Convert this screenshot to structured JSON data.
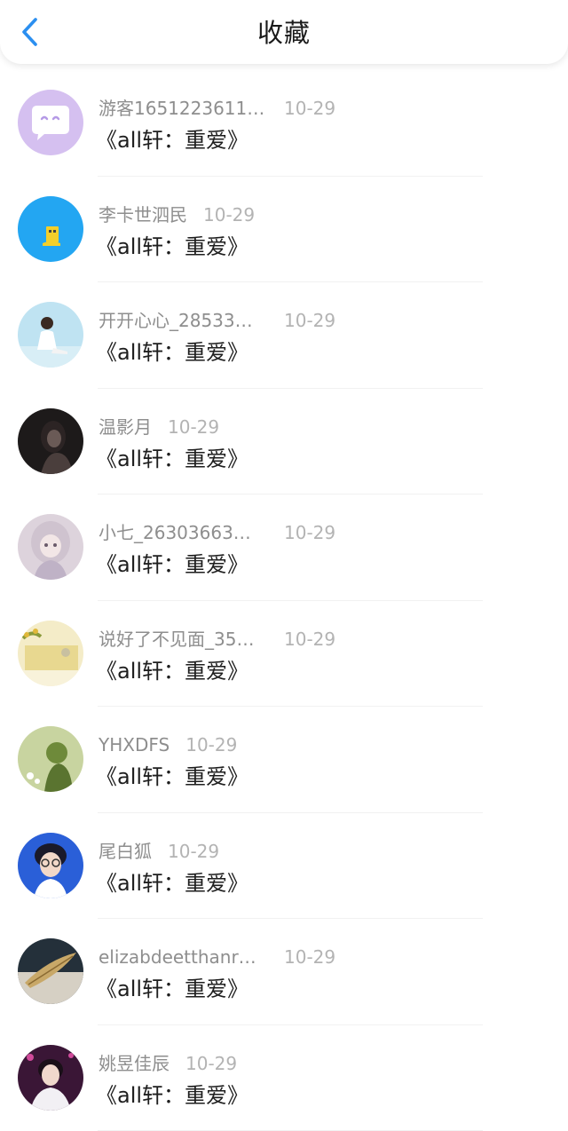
{
  "header": {
    "title": "收藏",
    "back_icon": "chevron-left-icon",
    "accent_color": "#2b8ff0"
  },
  "favorites": [
    {
      "user": "游客1651223611…",
      "date": "10-29",
      "title": "《all轩：重爱》"
    },
    {
      "user": "李卡世泗民",
      "date": "10-29",
      "title": "《all轩：重爱》"
    },
    {
      "user": "开开心心_28533…",
      "date": "10-29",
      "title": "《all轩：重爱》"
    },
    {
      "user": "温影月",
      "date": "10-29",
      "title": "《all轩：重爱》"
    },
    {
      "user": "小七_26303663…",
      "date": "10-29",
      "title": "《all轩：重爱》"
    },
    {
      "user": "说好了不见面_35…",
      "date": "10-29",
      "title": "《all轩：重爱》"
    },
    {
      "user": "YHXDFS",
      "date": "10-29",
      "title": "《all轩：重爱》"
    },
    {
      "user": "尾白狐",
      "date": "10-29",
      "title": "《all轩：重爱》"
    },
    {
      "user": "elizabdeetthanr…",
      "date": "10-29",
      "title": "《all轩：重爱》"
    },
    {
      "user": "姚昱佳辰",
      "date": "10-29",
      "title": "《all轩：重爱》"
    }
  ]
}
